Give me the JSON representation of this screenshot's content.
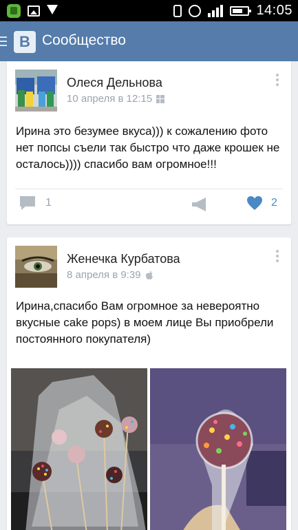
{
  "status_bar": {
    "time": "14:05"
  },
  "app_bar": {
    "logo_letter": "B",
    "title": "Сообщество"
  },
  "posts": [
    {
      "author": "Олеся Дельнова",
      "date": "10 апреля в 12:15",
      "platform_icon": "windows-icon",
      "text": "Ирина это безумее вкуса))) к сожалению фото нет попсы съели так быстро что даже крошек не осталось)))) спасибо вам огромное!!!",
      "comments": "1",
      "likes": "2"
    },
    {
      "author": "Женечка Курбатова",
      "date": "8 апреля в 9:39",
      "platform_icon": "apple-icon",
      "text": "Ирина,спасибо Вам огромное за невероятно вкусные cake pops) в моем лице Вы приобрели постоянного покупателя)"
    }
  ],
  "colors": {
    "app_bar": "#557caa",
    "like_blue": "#4a89c5",
    "feed_bg": "#ecedf0"
  }
}
